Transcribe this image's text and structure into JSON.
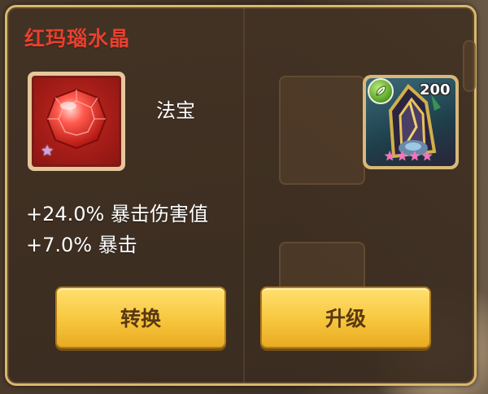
{
  "item": {
    "name": "红玛瑙水晶",
    "category": "法宝",
    "rarity_stars": 1,
    "icon": "red-gem-icon"
  },
  "hero": {
    "level": "200",
    "element": "leaf-element-icon",
    "stars": 4,
    "icon": "armored-hero-portrait"
  },
  "stats": [
    "+24.0% 暴击伤害值",
    "+7.0% 暴击"
  ],
  "buttons": {
    "convert_label": "转换",
    "upgrade_label": "升级"
  },
  "colors": {
    "title": "#e8402e",
    "panel_border": "#d9b86a",
    "button": "#f7c63d",
    "button_text": "#5a3812"
  }
}
